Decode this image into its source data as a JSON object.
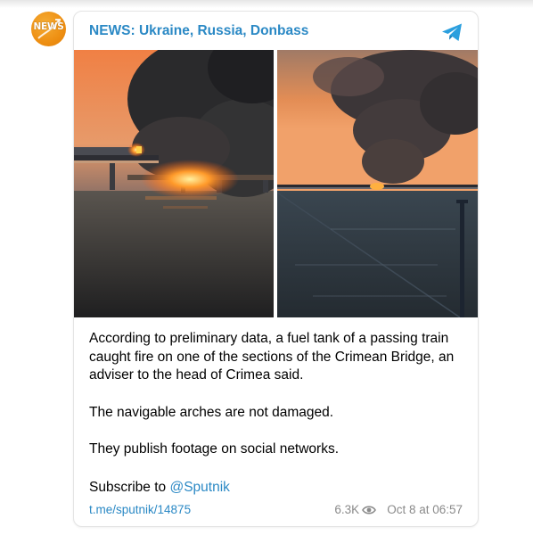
{
  "avatar": {
    "text": "NEWS"
  },
  "channel": {
    "title": "NEWS: Ukraine, Russia, Donbass"
  },
  "icons": {
    "telegram": "telegram-icon",
    "views": "eye-icon"
  },
  "photos": [
    {
      "name": "bridge-fire-photo-closeup"
    },
    {
      "name": "bridge-fire-photo-distant"
    }
  ],
  "post": {
    "paragraphs": [
      "According to preliminary data, a fuel tank of a passing train caught fire on one of the sections of the Crimean Bridge, an adviser to the head of Crimea said.",
      "The navigable arches are not damaged.",
      "They publish footage on social networks."
    ],
    "subscribe_text": "Subscribe to ",
    "subscribe_handle": "@Sputnik"
  },
  "footer": {
    "link": "t.me/sputnik/14875",
    "views": "6.3K",
    "date": "Oct 8 at 06:57"
  },
  "colors": {
    "accent": "#2b89c5",
    "avatar_orange": "#ee8f12",
    "meta_gray": "#8a8a8a"
  }
}
